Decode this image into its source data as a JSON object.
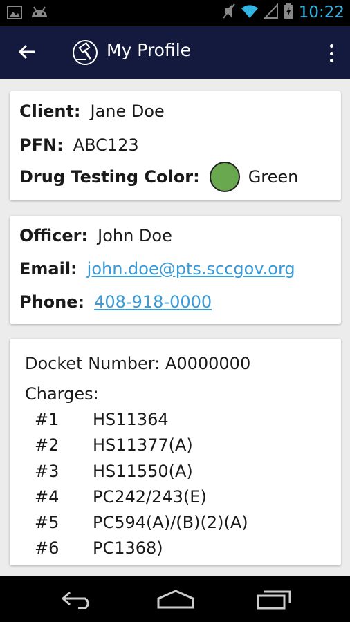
{
  "status_bar": {
    "time": "10:22",
    "icons": [
      "image-icon",
      "android-icon",
      "mute-icon",
      "wifi-icon",
      "signal-icon",
      "battery-icon"
    ]
  },
  "app_bar": {
    "title": "My Profile",
    "icons": [
      "back-arrow-icon",
      "app-logo-icon",
      "overflow-menu-icon"
    ]
  },
  "client_card": {
    "client_label": "Client:",
    "client_value": "Jane Doe",
    "pfn_label": "PFN:",
    "pfn_value": "ABC123",
    "drug_color_label": "Drug Testing Color:",
    "drug_color_value": "Green",
    "drug_color_hex": "#6aa84f"
  },
  "officer_card": {
    "officer_label": "Officer:",
    "officer_value": "John Doe",
    "email_label": "Email:",
    "email_value": "john.doe@pts.sccgov.org",
    "phone_label": "Phone:",
    "phone_value": "408-918-0000",
    "link_color": "#3a9bd9"
  },
  "docket_card": {
    "docket_text": "Docket Number: A0000000",
    "charges_title": "Charges:",
    "charges": [
      {
        "num": "#1",
        "code": "HS11364"
      },
      {
        "num": "#2",
        "code": "HS11377(A)"
      },
      {
        "num": "#3",
        "code": "HS11550(A)"
      },
      {
        "num": "#4",
        "code": "PC242/243(E)"
      },
      {
        "num": "#5",
        "code": "PC594(A)/(B)(2)(A)"
      },
      {
        "num": "#6",
        "code": "PC1368)"
      }
    ]
  },
  "nav_bar": {
    "icons": [
      "nav-back-icon",
      "nav-home-icon",
      "nav-recents-icon"
    ]
  },
  "theme": {
    "app_bar_color": "#141a3d",
    "status_time_color": "#33b5e5"
  }
}
